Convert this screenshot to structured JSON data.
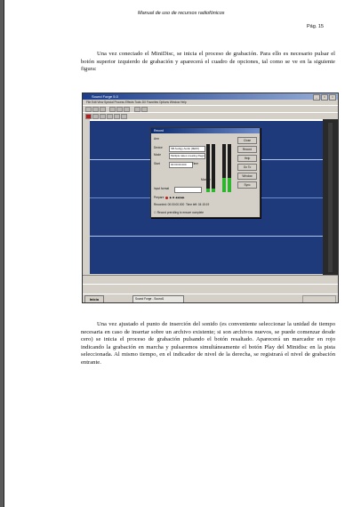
{
  "header": {
    "title": "Manual de uso de recursos radiofónicos",
    "page": "Pág. 15"
  },
  "paragraph1": "Una vez conectado el MiniDisc, se inicia el proceso de grabación. Para ello es necesario pulsar el botón superior izquierdo de grabación y aparecerá el cuadro de opciones, tal como se ve en la siguiente figura:",
  "paragraph2": "Una vez ajustado el punto de inserción del sonido (es conveniente seleccionar la unidad de tiempo necesaria en caso de insertar sobre un archivo existente; si son archivos nuevos, se puede comenzar desde cero) se inicia el proceso de grabación pulsando el botón resaltado. Aparecerá un marcador en rojo indicando la grabación en marcha y pulsaremos simultáneamente el botón Play del Minidisc en la pista seleccionada. Al mismo tiempo, en el indicador de nivel de la derecha, se registrará el nivel de grabación entrante.",
  "figure": {
    "window_title": "Sound Forge 5.0",
    "menu": "File  Edit  View  Special  Process  Effects  Tools  DX Favorites  Options  Window  Help",
    "dialog": {
      "title": "Record",
      "mode_value": "Multiple takes creating Regions",
      "device_value": "SB Audigy Audio [9E00]",
      "start_value": "00:00:00.000",
      "time_label": "Time",
      "buttons": [
        "Close",
        "Record",
        "Help",
        "Go To",
        "Window",
        "Sync"
      ],
      "arm_label": "Arm",
      "prepare_label": "Prepare",
      "monitor_label": "Monitor",
      "level_label": "DC adjust",
      "recorded_label": "Recorded",
      "remaining_label": "Time left",
      "recorded_value": "00:00:00.000",
      "remaining_value": "04:15:19",
      "footer_check": "Record prerolling to ensure complete"
    },
    "taskbar": {
      "start": "Inicio",
      "task": "Sound Forge - Sound1"
    }
  }
}
